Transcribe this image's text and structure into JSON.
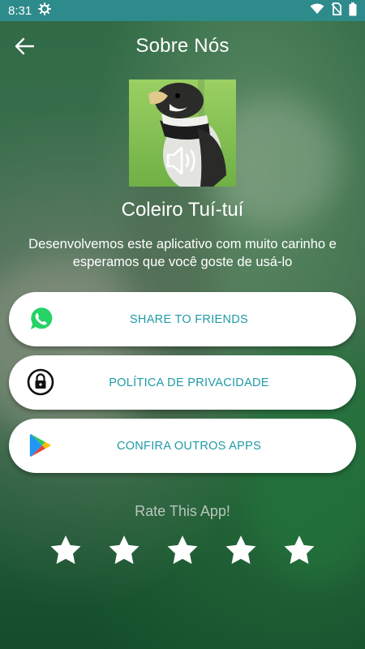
{
  "status_bar": {
    "time": "8:31",
    "icons": [
      "settings-gear-icon",
      "wifi-icon",
      "no-sim-icon",
      "battery-icon"
    ]
  },
  "header": {
    "title": "Sobre Nós",
    "back_icon": "back-arrow-icon"
  },
  "app": {
    "name": "Coleiro Tuí-tuí",
    "image_overlay_icon": "speaker-icon",
    "description": "Desenvolvemos este aplicativo com muito carinho e esperamos que você goste de usá-lo"
  },
  "buttons": [
    {
      "label": "SHARE TO FRIENDS",
      "icon": "whatsapp-icon"
    },
    {
      "label": "POLÍTICA DE PRIVACIDADE",
      "icon": "lock-icon"
    },
    {
      "label": "CONFIRA OUTROS APPS",
      "icon": "play-store-icon"
    }
  ],
  "rating": {
    "label": "Rate This App!",
    "max_stars": 5,
    "selected": 0
  },
  "colors": {
    "status_bar": "#2e8b8b",
    "button_text": "#1f9aa6",
    "whatsapp": "#25d366"
  }
}
